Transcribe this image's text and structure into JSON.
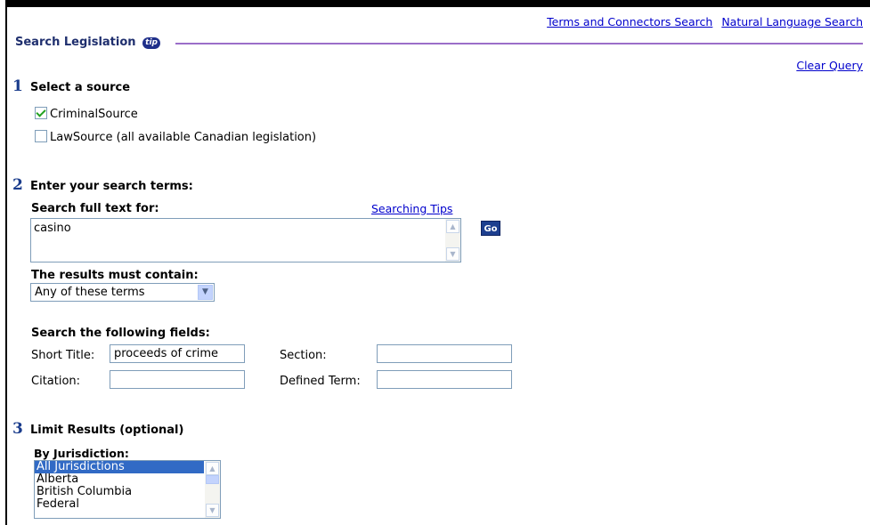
{
  "top_links": {
    "terms_connectors": "Terms and Connectors Search",
    "natural_language": "Natural Language Search"
  },
  "header": {
    "title": "Search Legislation",
    "tip_icon": "tip-icon"
  },
  "clear_query": "Clear Query",
  "step1": {
    "number": "1",
    "label": "Select a source",
    "sources": [
      {
        "label": "CriminalSource",
        "checked": true
      },
      {
        "label": "LawSource (all available Canadian legislation)",
        "checked": false
      }
    ]
  },
  "step2": {
    "number": "2",
    "label": "Enter your search terms:",
    "search_label": "Search full text for:",
    "searching_tips": "Searching Tips",
    "search_value": "casino",
    "go_label": "Go",
    "results_label": "The results must contain:",
    "results_selected": "Any of these terms",
    "fields_heading": "Search the following fields:",
    "short_title_label": "Short Title:",
    "short_title_value": "proceeds of crime",
    "section_label": "Section:",
    "section_value": "",
    "citation_label": "Citation:",
    "citation_value": "",
    "defined_term_label": "Defined Term:",
    "defined_term_value": ""
  },
  "step3": {
    "number": "3",
    "label": "Limit Results (optional)",
    "jurisdiction_label": "By Jurisdiction:",
    "jurisdictions": [
      "All Jurisdictions",
      "Alberta",
      "British Columbia",
      "Federal"
    ],
    "selected_jurisdiction": "All Jurisdictions"
  },
  "colors": {
    "link": "#0000cc",
    "accent_line": "#9b6ec9",
    "step_number": "#1a3c8c",
    "selection": "#316ac5"
  }
}
